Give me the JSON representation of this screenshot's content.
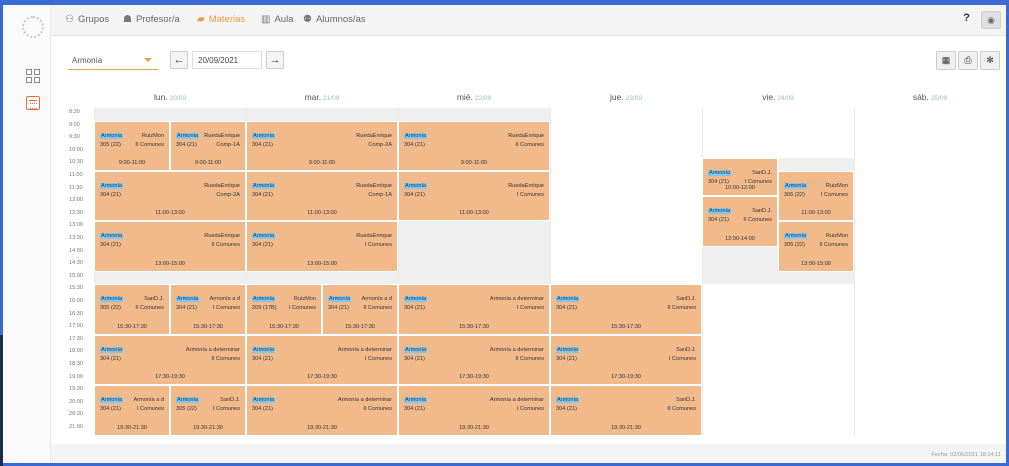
{
  "nav": {
    "tabs": [
      {
        "label": "Grupos",
        "icon": "users-icon"
      },
      {
        "label": "Profesor/a",
        "icon": "teacher-icon"
      },
      {
        "label": "Materias",
        "icon": "book-icon"
      },
      {
        "label": "Aula",
        "icon": "building-icon"
      },
      {
        "label": "Alumnos/as",
        "icon": "students-icon"
      }
    ],
    "help": "?"
  },
  "toolbar": {
    "subject": "Armonía",
    "date": "20/09/2021"
  },
  "days": [
    {
      "name": "lun.",
      "date": "20/09"
    },
    {
      "name": "mar.",
      "date": "21/09"
    },
    {
      "name": "mié.",
      "date": "22/09"
    },
    {
      "name": "jue.",
      "date": "23/09"
    },
    {
      "name": "vie.",
      "date": "24/09"
    },
    {
      "name": "sáb.",
      "date": "25/09"
    }
  ],
  "times": [
    "8:30",
    "9:00",
    "9:30",
    "10:00",
    "10:30",
    "11:00",
    "11:30",
    "12:00",
    "12:30",
    "13:00",
    "13:30",
    "14:00",
    "14:30",
    "15:00",
    "15:30",
    "16:00",
    "16:30",
    "17:00",
    "17:30",
    "18:00",
    "18:30",
    "19:00",
    "19:30",
    "20:00",
    "20:30",
    "21:00"
  ],
  "events": [
    {
      "day": 0,
      "half": 0,
      "start": "9:00",
      "end": "11:00",
      "subject": "Armonía",
      "room": "305 (22)",
      "teacher": "RuizMon",
      "group": "II Comunes",
      "time": "9:00-11:00"
    },
    {
      "day": 0,
      "half": 1,
      "start": "9:00",
      "end": "11:00",
      "subject": "Armonía",
      "room": "304 (21)",
      "teacher": "RuedaEnrique",
      "group": "Comp-1A",
      "time": "9:00-11:00"
    },
    {
      "day": 1,
      "half": -1,
      "start": "9:00",
      "end": "11:00",
      "subject": "Armonía",
      "room": "304 (21)",
      "teacher": "RuedaEnrique",
      "group": "Comp-2A",
      "time": "9:00-11:00"
    },
    {
      "day": 2,
      "half": -1,
      "start": "9:00",
      "end": "11:00",
      "subject": "Armonía",
      "room": "304 (21)",
      "teacher": "RuedaEnrique",
      "group": "II Comunes",
      "time": "9:00-11:00"
    },
    {
      "day": 0,
      "half": -1,
      "start": "11:00",
      "end": "13:00",
      "subject": "Armonía",
      "room": "304 (21)",
      "teacher": "RuedaEnrique",
      "group": "Comp-2A",
      "time": "11:00-13:00"
    },
    {
      "day": 1,
      "half": -1,
      "start": "11:00",
      "end": "13:00",
      "subject": "Armonía",
      "room": "304 (21)",
      "teacher": "RuedaEnrique",
      "group": "Comp-1A",
      "time": "11:00-13:00"
    },
    {
      "day": 2,
      "half": -1,
      "start": "11:00",
      "end": "13:00",
      "subject": "Armonía",
      "room": "304 (21)",
      "teacher": "RuedaEnrique",
      "group": "I Comunes",
      "time": "11:00-13:00"
    },
    {
      "day": 0,
      "half": -1,
      "start": "13:00",
      "end": "15:00",
      "subject": "Armonía",
      "room": "304 (21)",
      "teacher": "RuedaEnrique",
      "group": "II Comunes",
      "time": "13:00-15:00"
    },
    {
      "day": 1,
      "half": -1,
      "start": "13:00",
      "end": "15:00",
      "subject": "Armonía",
      "room": "304 (21)",
      "teacher": "RuedaEnrique",
      "group": "I Comunes",
      "time": "13:00-15:00"
    },
    {
      "day": 4,
      "half": 0,
      "start": "10:30",
      "end": "12:00",
      "subject": "Armonía",
      "room": "304 (21)",
      "teacher": "SanD.J.",
      "group": "I Comunes",
      "time": "10:00-12:00"
    },
    {
      "day": 4,
      "half": 0,
      "start": "12:00",
      "end": "14:00",
      "subject": "Armonía",
      "room": "304 (21)",
      "teacher": "SanD.J.",
      "group": "II Comunes",
      "time": "12:00-14:00"
    },
    {
      "day": 4,
      "half": 1,
      "start": "11:00",
      "end": "13:00",
      "subject": "Armonía",
      "room": "305 (22)",
      "teacher": "RuizMon",
      "group": "I Comunes",
      "time": "11:00-13:00"
    },
    {
      "day": 4,
      "half": 1,
      "start": "13:00",
      "end": "15:00",
      "subject": "Armonía",
      "room": "305 (22)",
      "teacher": "RuizMon",
      "group": "II Comunes",
      "time": "13:00-15:00"
    },
    {
      "day": 0,
      "half": 0,
      "start": "15:30",
      "end": "17:30",
      "subject": "Armonía",
      "room": "305 (22)",
      "teacher": "SanD.J.",
      "group": "II Comunes",
      "time": "15:30-17:30"
    },
    {
      "day": 0,
      "half": 1,
      "start": "15:30",
      "end": "17:30",
      "subject": "Armonía",
      "room": "304 (21)",
      "teacher": "Armonía a d",
      "group": "I Comunes",
      "time": "15:30-17:30"
    },
    {
      "day": 1,
      "half": 0,
      "start": "15:30",
      "end": "17:30",
      "subject": "Armonía",
      "room": "209 (17B)",
      "teacher": "RuizMon",
      "group": "I Comunes",
      "time": "15:30-17:30"
    },
    {
      "day": 1,
      "half": 1,
      "start": "15:30",
      "end": "17:30",
      "subject": "Armonía",
      "room": "304 (21)",
      "teacher": "Armonía a d",
      "group": "II Comunes",
      "time": "15:30-17:30"
    },
    {
      "day": 2,
      "half": -1,
      "start": "15:30",
      "end": "17:30",
      "subject": "Armonía",
      "room": "304 (21)",
      "teacher": "Armonía a determinar",
      "group": "I Comunes",
      "time": "15:30-17:30"
    },
    {
      "day": 3,
      "half": -1,
      "start": "15:30",
      "end": "17:30",
      "subject": "Armonía",
      "room": "304 (21)",
      "teacher": "SanD.J.",
      "group": "II Comunes",
      "time": "15:30-17:30"
    },
    {
      "day": 0,
      "half": -1,
      "start": "17:30",
      "end": "19:30",
      "subject": "Armonía",
      "room": "304 (21)",
      "teacher": "Armonía a determinar",
      "group": "II Comunes",
      "time": "17:30-19:30"
    },
    {
      "day": 1,
      "half": -1,
      "start": "17:30",
      "end": "19:30",
      "subject": "Armonía",
      "room": "304 (21)",
      "teacher": "Armonía a determinar",
      "group": "I Comunes",
      "time": "17:30-19:30"
    },
    {
      "day": 2,
      "half": -1,
      "start": "17:30",
      "end": "19:30",
      "subject": "Armonía",
      "room": "304 (21)",
      "teacher": "Armonía a determinar",
      "group": "II Comunes",
      "time": "17:30-19:30"
    },
    {
      "day": 3,
      "half": -1,
      "start": "17:30",
      "end": "19:30",
      "subject": "Armonía",
      "room": "304 (21)",
      "teacher": "SanD.J.",
      "group": "I Comunes",
      "time": "17:30-19:30"
    },
    {
      "day": 0,
      "half": 0,
      "start": "19:30",
      "end": "21:30",
      "subject": "Armonía",
      "room": "304 (21)",
      "teacher": "Armonía a d",
      "group": "I Comunes",
      "time": "19:30-21:30"
    },
    {
      "day": 0,
      "half": 1,
      "start": "19:30",
      "end": "21:30",
      "subject": "Armonía",
      "room": "305 (22)",
      "teacher": "SanD.J.",
      "group": "I Comunes",
      "time": "19:30-21:30"
    },
    {
      "day": 1,
      "half": -1,
      "start": "19:30",
      "end": "21:30",
      "subject": "Armonía",
      "room": "304 (21)",
      "teacher": "Armonía a determinar",
      "group": "II Comunes",
      "time": "19:30-21:30"
    },
    {
      "day": 2,
      "half": -1,
      "start": "19:30",
      "end": "21:30",
      "subject": "Armonía",
      "room": "304 (21)",
      "teacher": "Armonía a determinar",
      "group": "I Comunes",
      "time": "19:30-21:30"
    },
    {
      "day": 3,
      "half": -1,
      "start": "19:30",
      "end": "21:30",
      "subject": "Armonía",
      "room": "304 (21)",
      "teacher": "SanD.J.",
      "group": "II Comunes",
      "time": "19:30-21:30"
    }
  ],
  "footer": "Fecha: 02/06/2021 18:14:11",
  "colors": {
    "accent": "#e69a3a",
    "event": "#f2b98a",
    "subject_tag": "#7fc6f0",
    "frame": "#3a6ad4"
  }
}
